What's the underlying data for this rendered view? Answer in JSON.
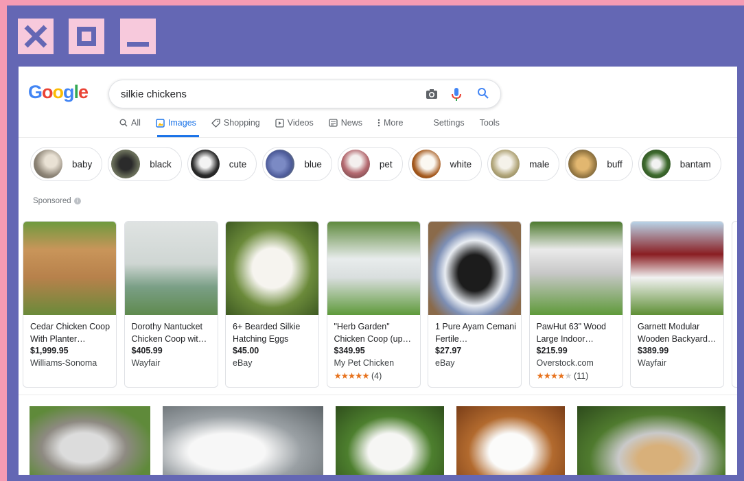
{
  "window": {
    "controls": [
      "close-icon",
      "maximize-icon",
      "minimize-icon"
    ]
  },
  "logo": {
    "text": "Google"
  },
  "search": {
    "query": "silkie chickens"
  },
  "tabs": [
    {
      "label": "All",
      "icon": "search-icon"
    },
    {
      "label": "Images",
      "icon": "image-icon",
      "active": true
    },
    {
      "label": "Shopping",
      "icon": "tag-icon"
    },
    {
      "label": "Videos",
      "icon": "play-icon"
    },
    {
      "label": "News",
      "icon": "news-icon"
    },
    {
      "label": "More",
      "icon": "more-vertical-icon"
    },
    {
      "label": "Settings"
    },
    {
      "label": "Tools"
    }
  ],
  "chips": [
    {
      "label": "baby"
    },
    {
      "label": "black"
    },
    {
      "label": "cute"
    },
    {
      "label": "blue"
    },
    {
      "label": "pet"
    },
    {
      "label": "white"
    },
    {
      "label": "male"
    },
    {
      "label": "buff"
    },
    {
      "label": "bantam"
    }
  ],
  "sponsored": {
    "label": "Sponsored"
  },
  "products": [
    {
      "title": "Cedar Chicken Coop With Planter…",
      "price": "$1,999.95",
      "store": "Williams-Sonoma",
      "rating": ""
    },
    {
      "title": "Dorothy Nantucket Chicken Coop wit…",
      "price": "$405.99",
      "store": "Wayfair",
      "rating": ""
    },
    {
      "title": "6+ Bearded Silkie Hatching Eggs",
      "price": "$45.00",
      "store": "eBay",
      "rating": ""
    },
    {
      "title": "\"Herb Garden\" Chicken Coop (up…",
      "price": "$349.95",
      "store": "My Pet Chicken",
      "rating": "(4)",
      "stars": 4.5
    },
    {
      "title": "1 Pure Ayam Cemani Fertile…",
      "price": "$27.97",
      "store": "eBay",
      "rating": ""
    },
    {
      "title": "PawHut 63\" Wood Large Indoor…",
      "price": "$215.99",
      "store": "Overstock.com",
      "rating": "(11)",
      "stars": 3.5
    },
    {
      "title": "Garnett Modular Wooden Backyard…",
      "price": "$389.99",
      "store": "Wayfair",
      "rating": ""
    }
  ],
  "colors": {
    "frame": "#6467b4",
    "background": "#f59bb3",
    "accent": "#1a73e8"
  }
}
